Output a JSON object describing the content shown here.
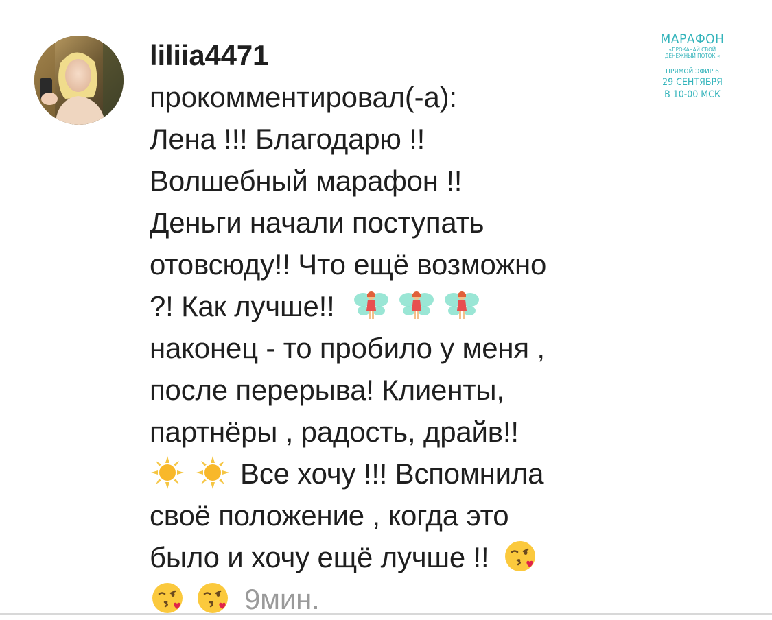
{
  "comment": {
    "username": "liliia4471",
    "action": "прокомментировал(-а):",
    "lines": [
      "Лена !!! Благодарю !!",
      "Волшебный марафон !!",
      "Деньги начали поступать",
      "отовсюду!! Что ещё возможно",
      "?! Как лучше!!",
      "наконец - то пробило у меня ,",
      "после перерыва! Клиенты,",
      "партнёры , радость, драйв!!",
      "Все хочу !!! Вспомнила",
      "своё положение , когда это",
      "было и хочу ещё лучше !!"
    ],
    "time": "9мин."
  },
  "icons": {
    "fairy": "fairy-emoji",
    "sun": "sun-emoji",
    "kiss": "face-blowing-kiss-emoji"
  },
  "promo": {
    "line1": "МАРАФОН",
    "line2": "«ПРОКАЧАЙ СВОЙ",
    "line3": "ДЕНЕЖНЫЙ ПОТОК «",
    "line4": "ПРЯМОЙ ЭФИР 6",
    "line5": "29 СЕНТЯБРЯ",
    "line6": "В 10-00 МСК"
  },
  "colors": {
    "accent": "#34b4bb",
    "text": "#1f1f1f",
    "muted": "#9a9a9a"
  }
}
